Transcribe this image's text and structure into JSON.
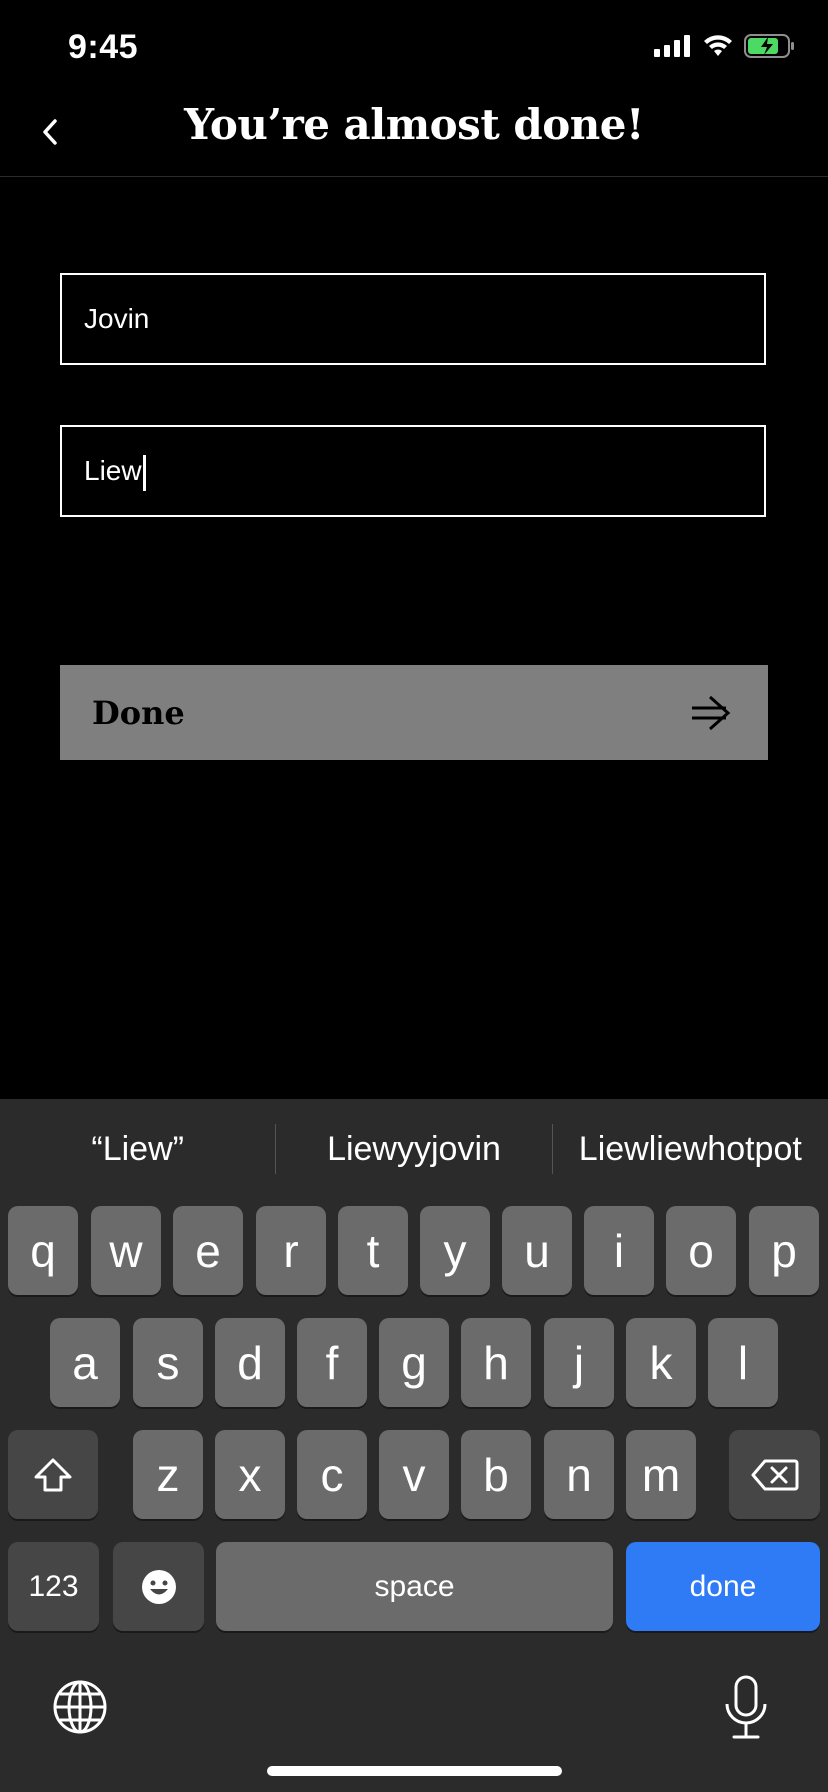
{
  "status": {
    "time": "9:45"
  },
  "header": {
    "title": "You’re almost done!"
  },
  "form": {
    "first_name": "Jovin",
    "last_name": "Liew",
    "done_label": "Done"
  },
  "keyboard": {
    "suggestions": [
      "“Liew”",
      "Liewyyjovin",
      "Liewliewhotpot"
    ],
    "row1": [
      "q",
      "w",
      "e",
      "r",
      "t",
      "y",
      "u",
      "i",
      "o",
      "p"
    ],
    "row2": [
      "a",
      "s",
      "d",
      "f",
      "g",
      "h",
      "j",
      "k",
      "l"
    ],
    "row3": [
      "z",
      "x",
      "c",
      "v",
      "b",
      "n",
      "m"
    ],
    "numbers_label": "123",
    "space_label": "space",
    "return_label": "done"
  },
  "colors": {
    "accent_blue": "#2f7af5",
    "button_grey": "#7f7f7f",
    "battery_green": "#4cd964"
  }
}
